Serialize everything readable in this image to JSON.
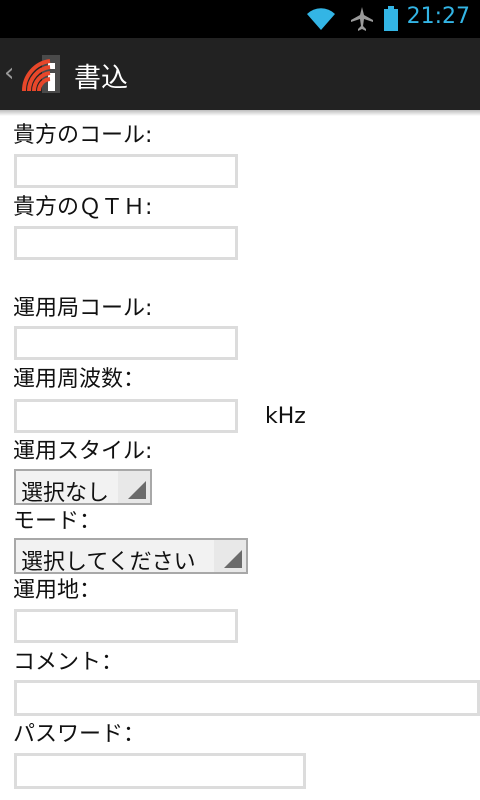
{
  "status_bar": {
    "time": "21:27"
  },
  "action_bar": {
    "title": "書込",
    "accent": "#e8472a"
  },
  "form": {
    "your_call": {
      "label": "貴方のコール:",
      "value": ""
    },
    "your_qth": {
      "label": "貴方のＱＴＨ:",
      "value": ""
    },
    "station_call": {
      "label": "運用局コール:",
      "value": ""
    },
    "frequency": {
      "label": "運用周波数：",
      "value": "",
      "unit": "kHz"
    },
    "style": {
      "label": "運用スタイル:",
      "selected": "選択なし"
    },
    "mode": {
      "label": "モード：",
      "selected": "選択してください"
    },
    "location": {
      "label": "運用地：",
      "value": ""
    },
    "comment": {
      "label": "コメント：",
      "value": ""
    },
    "password": {
      "label": "パスワード：",
      "value": ""
    }
  }
}
